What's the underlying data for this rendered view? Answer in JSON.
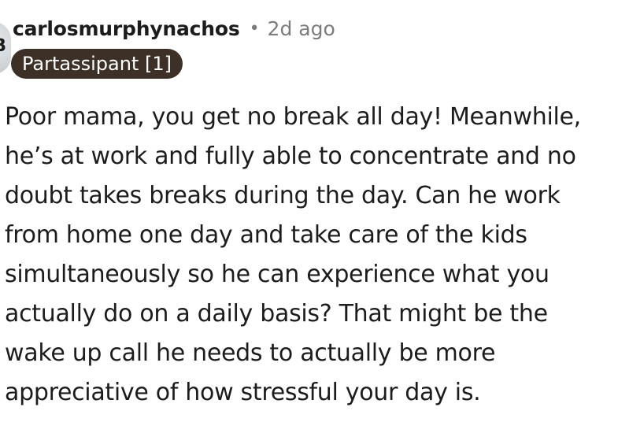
{
  "comment": {
    "author": "carlosmurphynachos",
    "separator": "•",
    "timestamp": "2d ago",
    "flair": "Partassipant [1]",
    "avatar_visible_glyph": "B",
    "body_lines": [
      "Poor mama, you get no break all day! Meanwhile,",
      "he’s at work and fully able to concentrate and no",
      "doubt takes breaks during the day. Can he work",
      "from home one day and take care of the kids",
      "simultaneously so he can experience what you",
      "actually do on a daily basis? That might be the",
      "wake up call he needs to actually be more",
      "appreciative of how stressful your day is."
    ]
  },
  "colors": {
    "flair_background": "#3d3127",
    "flair_text": "#ffffff",
    "username": "#1c1c1c",
    "meta_muted": "#7c7c7c",
    "body_text": "#1c1c1c"
  }
}
